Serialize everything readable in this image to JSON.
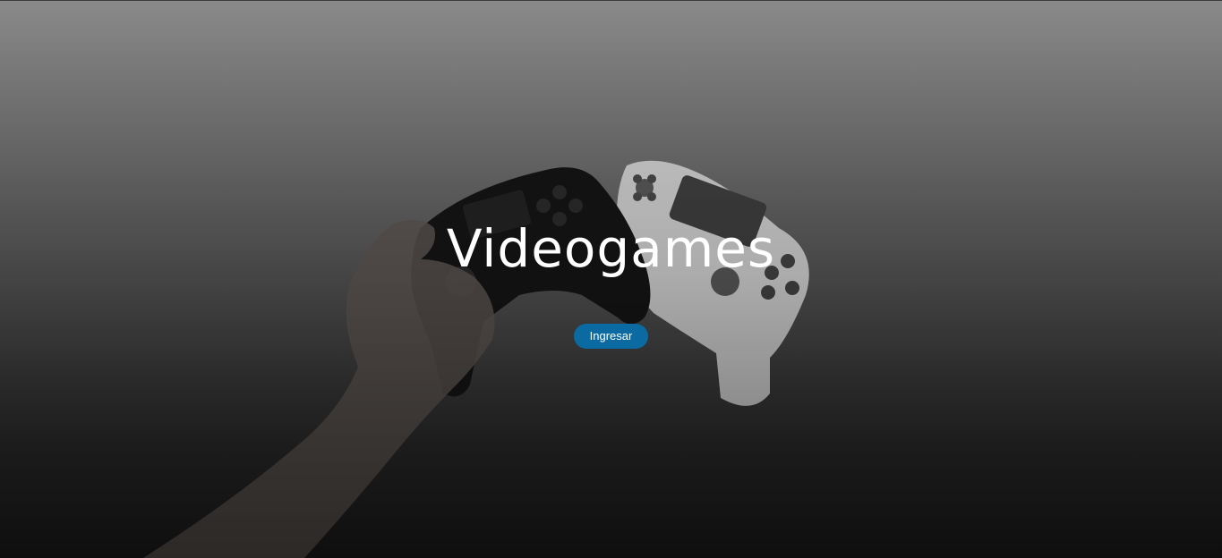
{
  "hero": {
    "title": "Videogames",
    "button_label": "Ingresar"
  },
  "colors": {
    "button_background": "#0b6aa2",
    "title_text": "#ffffff"
  }
}
